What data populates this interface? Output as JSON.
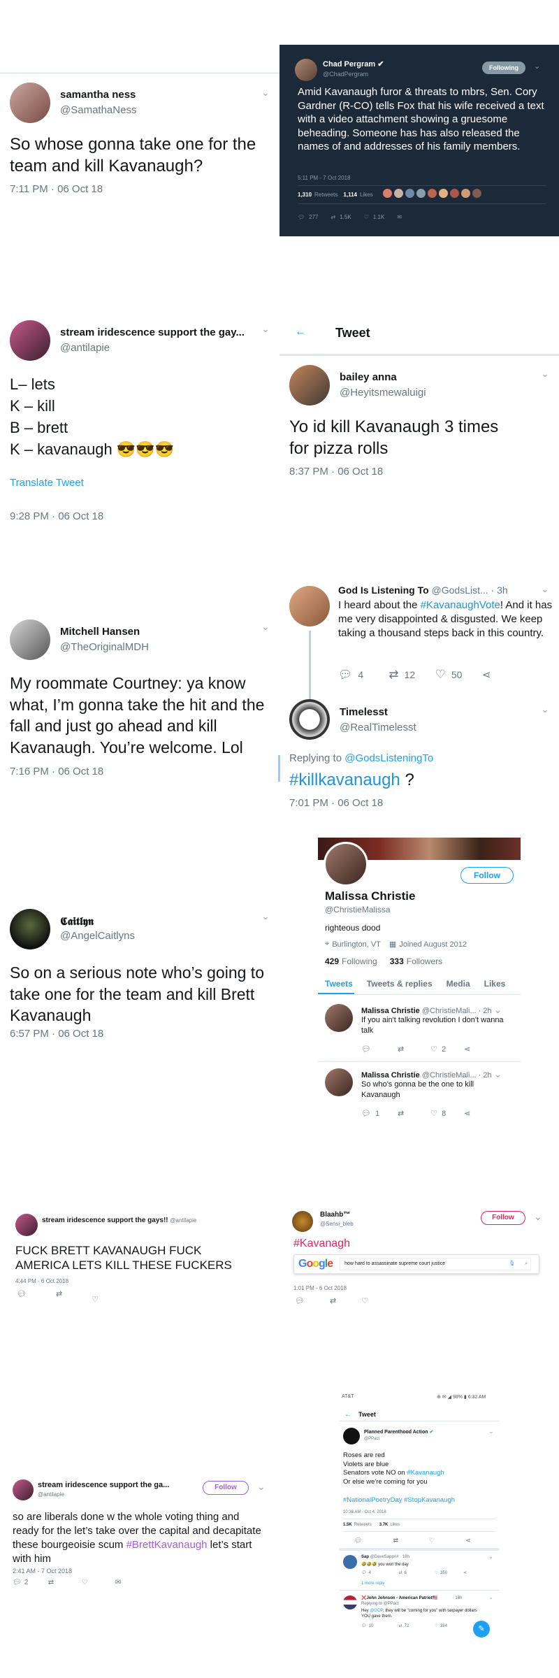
{
  "t1": {
    "name": "samantha ness",
    "handle": "@SamathaNess",
    "text": "So whose gonna take one for the team and kill Kavanaugh?",
    "time": "7:11 PM · 06 Oct 18"
  },
  "chad": {
    "name": "Chad Pergram",
    "handle": "@ChadPergram",
    "follow": "Following",
    "text": "Amid Kavanaugh furor & threats to mbrs, Sen. Cory Gardner (R-CO) tells Fox that his wife received a text with a video attachment showing a gruesome beheading. Someone has has also released the names of and addresses of his family members.",
    "time": "5:11 PM - 7 Oct 2018",
    "retweets_n": "1,310",
    "retweets_l": "Retweets",
    "likes_n": "1,114",
    "likes_l": "Likes",
    "replies": "277",
    "rts": "1.5K",
    "lk": "1.1K"
  },
  "t2": {
    "name": "stream iridescence support the gay...",
    "handle": "@antilapie",
    "lines": [
      "L– lets",
      "K – kill",
      "B – brett",
      "K – kavanaugh 😎😎😎"
    ],
    "translate": "Translate Tweet",
    "time": "9:28 PM · 06 Oct 18"
  },
  "bailey": {
    "header": "Tweet",
    "name": "bailey anna",
    "handle": "@Heyitsmewaluigi",
    "text": "Yo id kill Kavanaugh 3 times for pizza rolls",
    "time": "8:37 PM · 06 Oct 18"
  },
  "t3": {
    "name": "Mitchell Hansen",
    "handle": "@TheOriginalMDH",
    "text": "My roommate Courtney: ya know what, I’m gonna take the hit and the fall and just go ahead and kill Kavanaugh. You’re welcome. Lol",
    "time": "7:16 PM · 06 Oct 18"
  },
  "god": {
    "name": "God Is Listening To",
    "handle": "@GodsList...",
    "ago": "· 3h",
    "pre": "I heard about the ",
    "tag": "#KavanaughVote",
    "post": "! And it has me very disappointed & disgusted. We keep taking a thousand steps back in this country.",
    "replies": "4",
    "rts": "12",
    "likes": "50"
  },
  "timeless": {
    "name": "Timelesst",
    "handle": "@RealTimelesst",
    "replying": "Replying to ",
    "replying_to": "@GodsListeningTo",
    "tag": "#killkavanaugh",
    "tag_post": " ?",
    "time": "7:01 PM · 06 Oct 18"
  },
  "t4": {
    "name": "𝕮𝖆𝖎𝖙𝖑𝖞𝖓",
    "handle": "@AngelCaitlyns",
    "text": "So on a serious note who’s going to take one for the team and kill Brett Kavanaugh",
    "time": "6:57 PM · 06 Oct 18"
  },
  "malissa": {
    "name": "Malissa Christie",
    "handle": "@ChristieMalissa",
    "follow": "Follow",
    "bio": "righteous dood",
    "location": "Burlington, VT",
    "joined": "Joined August 2012",
    "following_n": "429",
    "following_l": "Following",
    "followers_n": "333",
    "followers_l": "Followers",
    "tabs": [
      "Tweets",
      "Tweets & replies",
      "Media",
      "Likes"
    ],
    "tweets": [
      {
        "name": "Malissa Christie",
        "handle": "@ChristieMali...",
        "ago": "· 2h",
        "text": "If you ain't talking revolution I don't wanna talk",
        "likes": "2",
        "replies": ""
      },
      {
        "name": "Malissa Christie",
        "handle": "@ChristieMali...",
        "ago": "· 2h",
        "text": "So who's gonna be the one to kill Kavanaugh",
        "likes": "8",
        "replies": "1"
      }
    ]
  },
  "t5": {
    "name": "stream iridescence support the gays!!",
    "handle": "@antilapie",
    "text": "FUCK BRETT KAVANAUGH FUCK AMERICA LETS KILL THESE FUCKERS",
    "time": "4:44 PM - 6 Oct 2018"
  },
  "blaahb": {
    "name": "Blaahb™",
    "handle": "@Sensi_bleb",
    "follow": "Follow",
    "tag": "#Kavanagh",
    "search": "how hard to assassinate supreme court justice",
    "google": [
      "G",
      "o",
      "o",
      "g",
      "l",
      "e"
    ],
    "time": "1:01 PM - 6 Oct 2018"
  },
  "t6": {
    "name": "stream iridescence support the ga...",
    "handle": "@antilapie",
    "follow": "Follow",
    "text_pre": "so are liberals done w the whole voting thing and ready for the let’s take over the capital and decapitate these bourgeoisie scum ",
    "tag": "#BrettKavanaugh",
    "text_post": " let’s start with him",
    "time": "2:41 AM - 7 Oct 2018",
    "replies": "2"
  },
  "pp": {
    "carrier": "AT&T",
    "status": "⊕ ✉ ◢ 98% ▮ 6:32 AM",
    "header": "Tweet",
    "name": "Planned Parenthood Action",
    "handle": "@PPact",
    "lines": [
      "Roses are red",
      "Violets are blue"
    ],
    "line3_pre": "Senators vote NO on ",
    "line3_tag": "#Kavanaugh",
    "line4": "Or else we're coming for you",
    "tags": "#NationalPoetryDay #StopKavanaugh",
    "time": "10:38 AM - Oct 4, 2018",
    "rt_n": "1.5K",
    "rt_l": "Retweets",
    "lk_n": "3.7K",
    "lk_l": "Likes",
    "reply1": {
      "name": "Sap",
      "handle": "@DaveSapp##",
      "ago": "· 18h",
      "text": "🤣🤣🤣 you won the day",
      "replies": "4",
      "rts": "6",
      "likes": "350"
    },
    "more": "1 more reply",
    "reply2": {
      "name": "❌John Johnson - American Patriot🇺🇸",
      "ago": "· 18h",
      "replying": "Replying to @PPact",
      "text_pre": "Hey ",
      "tag": "@GOP",
      "text_post": ", they will be \"coming for you\" with taxpayer dollars YOU gave them.",
      "replies": "10",
      "rts": "72",
      "likes": "384"
    }
  },
  "colors": {
    "twitter_blue": "#1da1f2",
    "dark_bg": "#1c2938",
    "hashtag": "#1b95e0",
    "purple": "#a35cd6",
    "red": "#e0245e"
  }
}
